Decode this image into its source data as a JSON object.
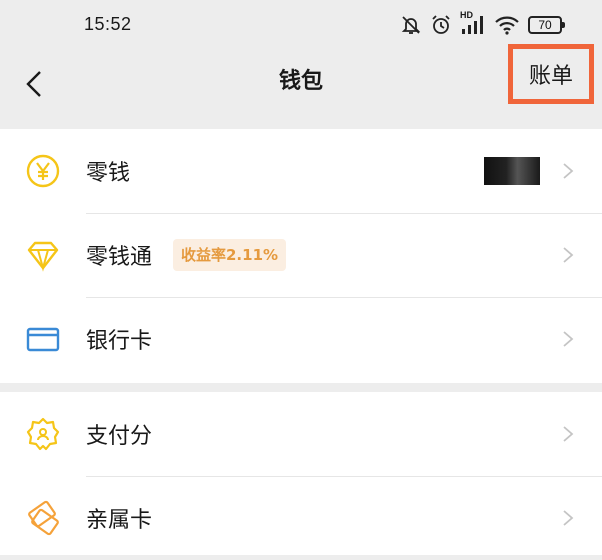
{
  "status_bar": {
    "time": "15:52",
    "network_label": "HD",
    "battery": "70",
    "icons": [
      "bell-muted-icon",
      "alarm-icon",
      "signal-icon",
      "wifi-icon",
      "battery-icon"
    ]
  },
  "nav": {
    "title": "钱包",
    "bill_label": "账单",
    "back_icon": "chevron-left-icon"
  },
  "groups": [
    {
      "items": [
        {
          "label": "零钱",
          "icon": "yuan-coin-icon",
          "color": "#f5c518"
        },
        {
          "label": "零钱通",
          "icon": "diamond-icon",
          "color": "#f5c518",
          "badge": "收益率2.11%"
        },
        {
          "label": "银行卡",
          "icon": "card-icon",
          "color": "#3a8ad6"
        }
      ]
    },
    {
      "items": [
        {
          "label": "支付分",
          "icon": "badge-star-icon",
          "color": "#f5c518"
        },
        {
          "label": "亲属卡",
          "icon": "family-card-icon",
          "color": "#f5a23a"
        }
      ]
    }
  ],
  "colors": {
    "highlight": "#f0653a",
    "badge_text": "#e59a3f",
    "badge_bg": "#fbeee1",
    "background": "#ededed"
  }
}
